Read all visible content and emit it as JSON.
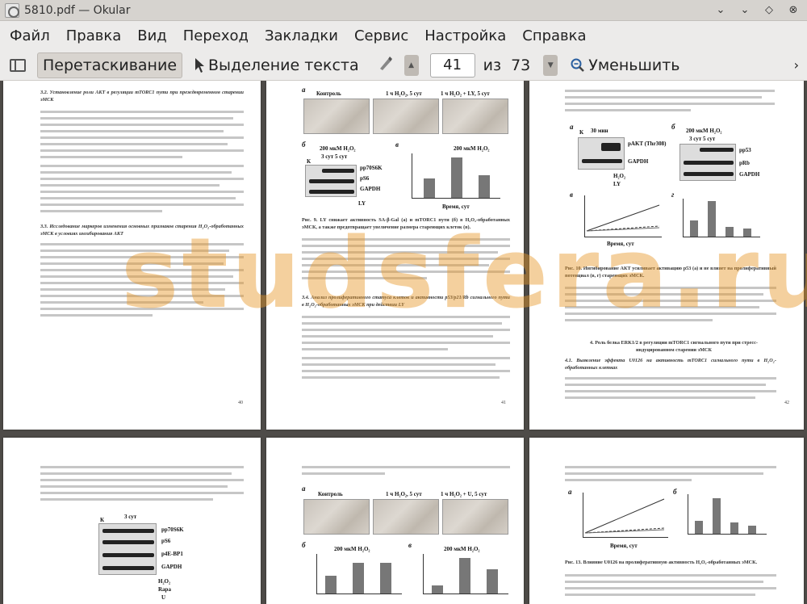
{
  "window": {
    "title": "5810.pdf — Okular"
  },
  "menu": [
    "Файл",
    "Правка",
    "Вид",
    "Переход",
    "Закладки",
    "Сервис",
    "Настройка",
    "Справка"
  ],
  "toolbar": {
    "drag": "Перетаскивание",
    "select_text": "Выделение текста",
    "page_current": "41",
    "of": "из",
    "page_total": "73",
    "zoom_out": "Уменьшить"
  },
  "pages": {
    "p40": {
      "number": "40",
      "heading1": "3.2. Установление роли АКТ в регуляции mTORC1 пути при преждевременном старении эМСК",
      "heading2": "3.3. Исследование маркеров изменения основных признаков старения H₂O₂-обработанных эМСК в условиях ингибирования АКТ"
    },
    "p41": {
      "number": "41",
      "labels": {
        "a": "а",
        "b": "б",
        "v": "в",
        "control": "Контроль",
        "h1": "1 ч H₂O₂, 5 сут",
        "h2": "1 ч H₂O₂ + LY, 5 сут",
        "conc": "200 мкМ H₂O₂",
        "days": "3 сут   5 сут",
        "k": "К",
        "ly": "LY",
        "time": "Время, сут"
      },
      "bands": [
        "pp70S6K",
        "pS6",
        "GAPDH"
      ],
      "caption": "Рис. 9. LY снижает активность SA-β-Gal (а) и mTORC1 пути (б) в H₂O₂-обработанных эМСК, а также предотвращает увеличение размера стареющих клеток (в).",
      "heading": "3.4. Анализ пролиферативного статуса клеток и активности p53/p21/Rb сигнального пути в H₂O₂-обработанных эМСК при действии LY"
    },
    "p42": {
      "number": "42",
      "labels": {
        "a": "а",
        "b": "б",
        "v": "в",
        "g": "г",
        "k": "К",
        "min30": "30 мин",
        "conc": "200 мкМ H₂O₂",
        "days": "3 сут   5 сут",
        "h2o2": "H₂O₂",
        "ly": "LY",
        "time": "Время, сут"
      },
      "bands_a": [
        "pAKT (Thr308)",
        "GAPDH"
      ],
      "bands_b": [
        "pp53",
        "pRb",
        "GAPDH"
      ],
      "caption": "Рис. 10. Ингибирование АКТ усиливает активацию p53 (а) и не влияет на пролиферативный потенциал (в, г) стареющих эМСК.",
      "heading1": "4. Роль белка ERK1/2 в регуляции mTORC1 сигнального пути при стресс-индуцированном старении эМСК",
      "heading2": "4.1. Выявление эффекта U0126 на активность mTORC1 сигнального пути в H₂O₂-обработанных клетках"
    },
    "p43": {
      "labels": {
        "k": "К",
        "days": "3 сут",
        "h2o2": "H₂O₂",
        "rapa": "Rapa",
        "u": "U"
      },
      "bands": [
        "pp70S6K",
        "pS6",
        "p4E-BP1",
        "GAPDH"
      ]
    },
    "p44": {
      "labels": {
        "a": "а",
        "b": "б",
        "v": "в",
        "control": "Контроль",
        "h1": "1 ч H₂O₂, 5 сут",
        "h2": "1 ч H₂O₂ + U, 5 сут",
        "conc": "200 мкМ H₂O₂"
      }
    },
    "p45": {
      "labels": {
        "a": "а",
        "b": "б",
        "time": "Время, сут"
      },
      "caption": "Рис. 13. Влияние U0126 на пролиферативную активность H₂O₂-обработанных эМСК."
    }
  },
  "watermark": "studsfera.ru"
}
